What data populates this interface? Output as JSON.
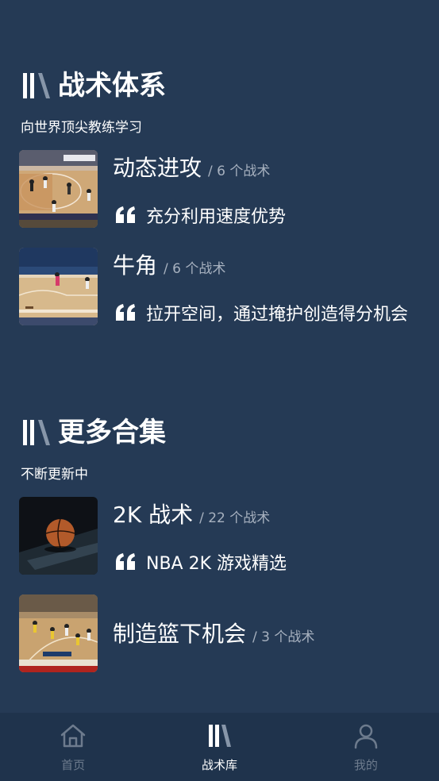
{
  "sections": [
    {
      "title": "战术体系",
      "subtitle": "向世界顶尖教练学习",
      "cards": [
        {
          "title": "动态进攻",
          "count": "/ 6 个战术",
          "quote": "充分利用速度优势"
        },
        {
          "title": "牛角",
          "count": "/ 6 个战术",
          "quote": "拉开空间，通过掩护创造得分机会"
        }
      ]
    },
    {
      "title": "更多合集",
      "subtitle": "不断更新中",
      "cards": [
        {
          "title": "2K 战术",
          "count": "/ 22 个战术",
          "quote": "NBA 2K 游戏精选"
        },
        {
          "title": "制造篮下机会",
          "count": "/ 3 个战术"
        }
      ]
    }
  ],
  "tabbar": {
    "items": [
      {
        "label": "首页",
        "icon": "home-icon",
        "active": false
      },
      {
        "label": "战术库",
        "icon": "tactics-library-icon",
        "active": true
      },
      {
        "label": "我的",
        "icon": "profile-icon",
        "active": false
      }
    ]
  },
  "colors": {
    "background": "#253a55",
    "tabbar": "#1f334c",
    "muted_text": "#a7b1bf",
    "inactive_tab": "#6d7b8d"
  }
}
